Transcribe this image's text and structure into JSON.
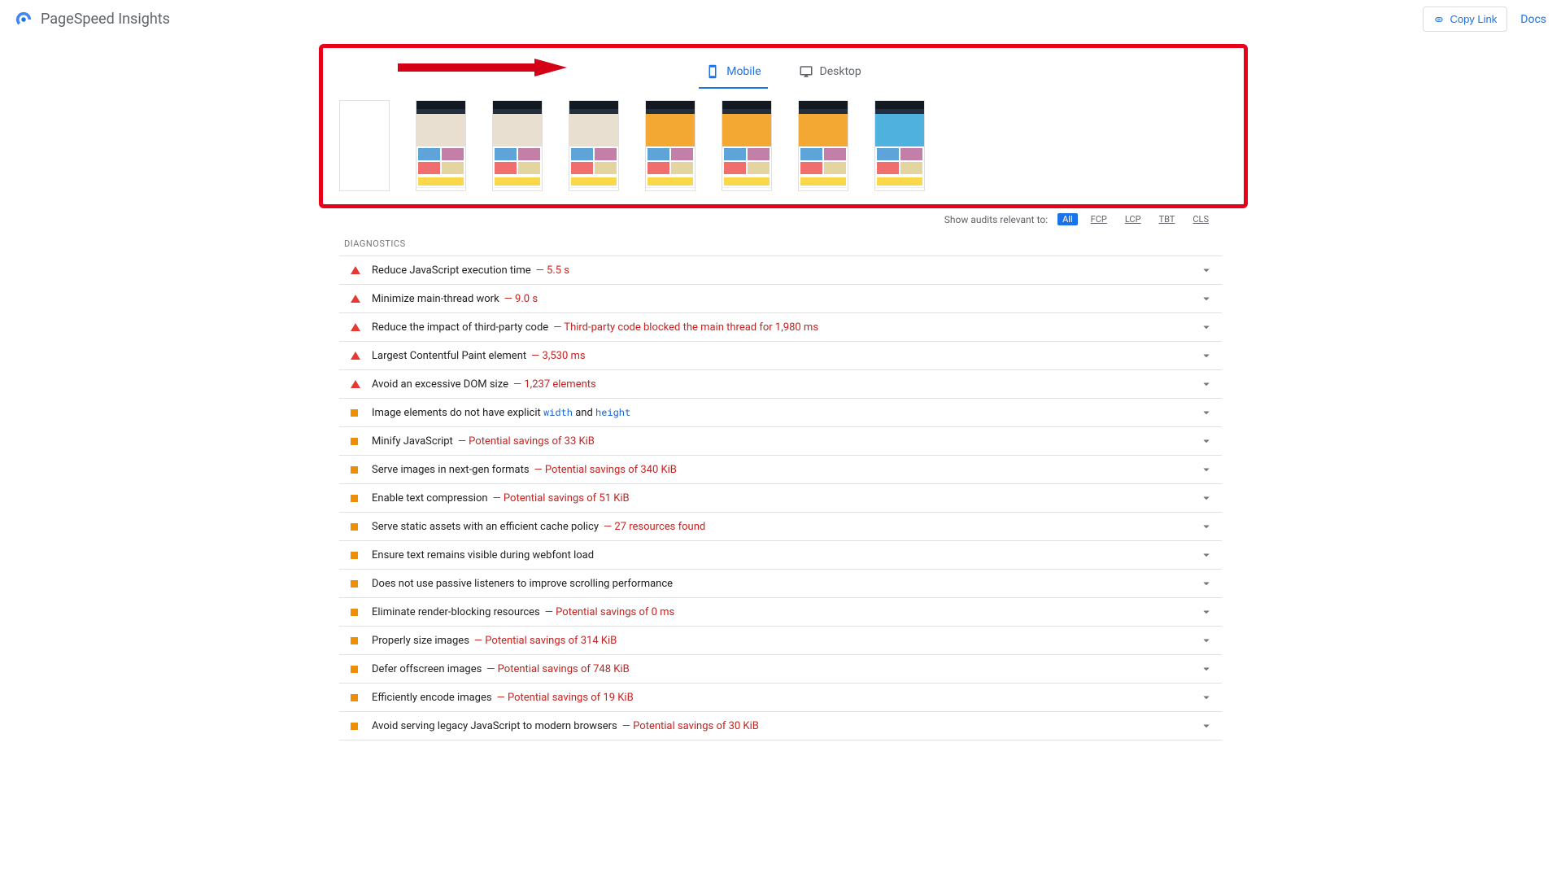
{
  "header": {
    "title": "PageSpeed Insights",
    "copy_link": "Copy Link",
    "docs": "Docs"
  },
  "tabs": {
    "mobile": "Mobile",
    "desktop": "Desktop"
  },
  "filter": {
    "label": "Show audits relevant to:",
    "all": "All",
    "fcp": "FCP",
    "lcp": "LCP",
    "tbt": "TBT",
    "cls": "CLS"
  },
  "sections": {
    "diagnostics": "DIAGNOSTICS"
  },
  "diagnostics": [
    {
      "severity": "fail",
      "title": "Reduce JavaScript execution time",
      "detail": "— 5.5 s"
    },
    {
      "severity": "fail",
      "title": "Minimize main-thread work",
      "detail": "— 9.0 s"
    },
    {
      "severity": "fail",
      "title": "Reduce the impact of third-party code",
      "detail": "— Third-party code blocked the main thread for 1,980 ms"
    },
    {
      "severity": "fail",
      "title": "Largest Contentful Paint element",
      "detail": "— 3,530 ms"
    },
    {
      "severity": "fail",
      "title": "Avoid an excessive DOM size",
      "detail": "— 1,237 elements"
    },
    {
      "severity": "warn",
      "title_html": "Image elements do not have explicit <span class=\"code\">width</span> and <span class=\"code\">height</span>",
      "detail": ""
    },
    {
      "severity": "warn",
      "title": "Minify JavaScript",
      "detail": "— Potential savings of 33 KiB"
    },
    {
      "severity": "warn",
      "title": "Serve images in next-gen formats",
      "detail": "— Potential savings of 340 KiB"
    },
    {
      "severity": "warn",
      "title": "Enable text compression",
      "detail": "— Potential savings of 51 KiB"
    },
    {
      "severity": "warn",
      "title": "Serve static assets with an efficient cache policy",
      "detail": "— 27 resources found"
    },
    {
      "severity": "warn",
      "title": "Ensure text remains visible during webfont load",
      "detail": ""
    },
    {
      "severity": "warn",
      "title": "Does not use passive listeners to improve scrolling performance",
      "detail": ""
    },
    {
      "severity": "warn",
      "title": "Eliminate render-blocking resources",
      "detail": "— Potential savings of 0 ms"
    },
    {
      "severity": "warn",
      "title": "Properly size images",
      "detail": "— Potential savings of 314 KiB"
    },
    {
      "severity": "warn",
      "title": "Defer offscreen images",
      "detail": "— Potential savings of 748 KiB"
    },
    {
      "severity": "warn",
      "title": "Efficiently encode images",
      "detail": "— Potential savings of 19 KiB"
    },
    {
      "severity": "warn",
      "title": "Avoid serving legacy JavaScript to modern browsers",
      "detail": "— Potential savings of 30 KiB"
    }
  ],
  "filmstrip_hero_variants": [
    "neutral",
    "neutral",
    "neutral",
    "neutral",
    "orange",
    "orange",
    "orange",
    "blue"
  ]
}
